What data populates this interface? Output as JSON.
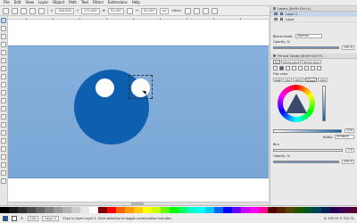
{
  "menu": [
    "File",
    "Edit",
    "View",
    "Layer",
    "Object",
    "Path",
    "Text",
    "Filters",
    "Extensions",
    "Help"
  ],
  "toolbar": {
    "x_label": "X",
    "x_value": "204.000",
    "y_label": "Y",
    "y_value": "173.429",
    "w_label": "W",
    "w_value": "51.007",
    "h_label": "H",
    "h_value": "51.007",
    "unit": "px",
    "affect_label": "Affect:"
  },
  "layers_panel": {
    "title": "Layers (Shift+Ctrl+L)",
    "layers": [
      {
        "name": "Layer 2",
        "selected": true
      },
      {
        "name": "Layer",
        "selected": false
      }
    ],
    "blend_label": "Blend mode:",
    "blend_value": "Normal",
    "opacity_label": "Opacity, %",
    "opacity_value": "100.0"
  },
  "fill_stroke_panel": {
    "title": "Fill and Stroke (Shift+Ctrl+F)",
    "tabs": [
      "Fill",
      "Stroke paint",
      "Stroke style"
    ],
    "flat_color_label": "Flat color",
    "color_tabs": [
      "RGB",
      "HSL",
      "CMYK",
      "Wheel",
      "CMS"
    ],
    "alpha_value": "255",
    "rgba_label": "RGBA:",
    "rgba_value": "0f5fb0ff",
    "blur_label": "Blur",
    "blur_value": "0.0",
    "opacity_label": "Opacity, %",
    "opacity_value": "100.0"
  },
  "status": {
    "zoom_label": "Z:",
    "zoom_value": "100",
    "layer_name": "Layer 2",
    "message": "51px in layer Layer 2. Click selection to toggle scale/rotation handles.",
    "coords": "X: 435.31  Y: 312.31"
  },
  "colors": {
    "fill": "#0f5fb0",
    "page": "#7aa7d6",
    "accent": "#5a7fae"
  },
  "icons": {
    "tool_icons": [
      "selector-icon",
      "node-icon",
      "tweak-icon",
      "zoom-icon",
      "measure-icon",
      "rect-icon",
      "3dbox-icon",
      "ellipse-icon",
      "star-icon",
      "spiral-icon",
      "pencil-icon",
      "pen-icon",
      "calligraphy-icon",
      "text-icon",
      "spray-icon",
      "eraser-icon",
      "bucket-icon",
      "gradient-icon",
      "mesh-icon",
      "dropper-icon",
      "connector-icon"
    ]
  }
}
